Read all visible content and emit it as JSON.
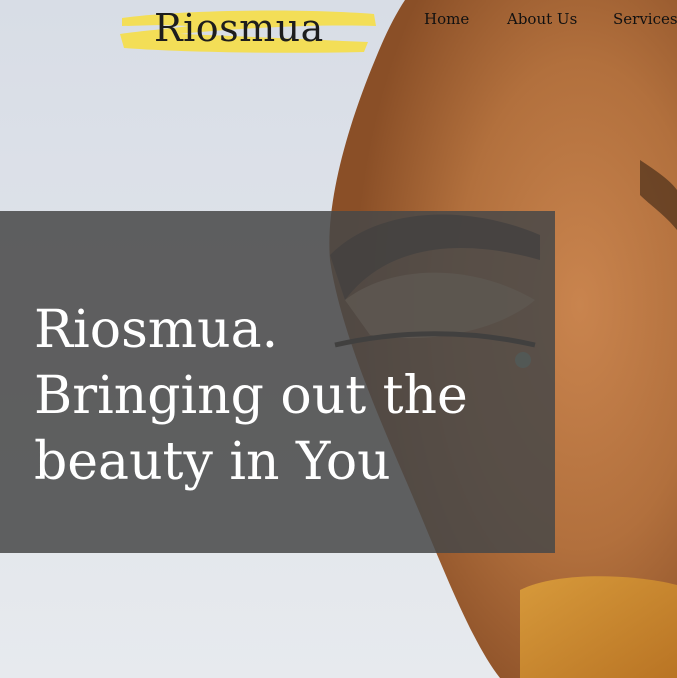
{
  "brand": {
    "logo_text": "Riosmua",
    "logo_color": "#f3de57"
  },
  "nav": {
    "items": [
      "Home",
      "About Us",
      "Services"
    ]
  },
  "hero": {
    "headline_lines": [
      "Riosmua.",
      "Bringing out the",
      "beauty in You"
    ],
    "image": "woman-face-makeup-closeup"
  },
  "colors": {
    "overlay": "#484848",
    "text_dark": "#111111",
    "headline": "#ffffff",
    "background": "#dfe3e9"
  }
}
